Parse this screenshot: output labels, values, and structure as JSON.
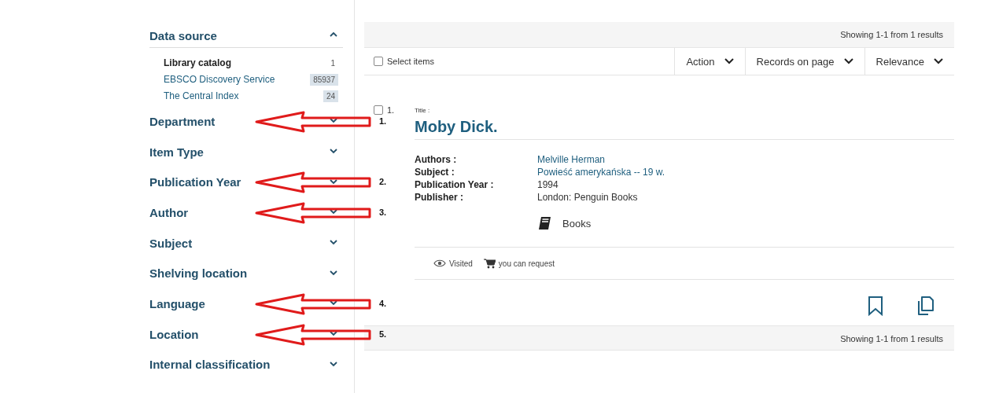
{
  "sidebar": {
    "data_source": {
      "title": "Data source",
      "expanded": true,
      "items": [
        {
          "name": "Library catalog",
          "count": "1",
          "selected": true
        },
        {
          "name": "EBSCO Discovery Service",
          "count": "85937",
          "selected": false
        },
        {
          "name": "The Central Index",
          "count": "24",
          "selected": false
        }
      ]
    },
    "facets": [
      {
        "label": "Department",
        "expanded": false,
        "annotation": "1."
      },
      {
        "label": "Item Type",
        "expanded": false
      },
      {
        "label": "Publication Year",
        "expanded": false,
        "annotation": "2."
      },
      {
        "label": "Author",
        "expanded": false,
        "annotation": "3."
      },
      {
        "label": "Subject",
        "expanded": false
      },
      {
        "label": "Shelving location",
        "expanded": false
      },
      {
        "label": "Language",
        "expanded": false,
        "annotation": "4."
      },
      {
        "label": "Location",
        "expanded": false,
        "annotation": "5."
      },
      {
        "label": "Internal classification",
        "expanded": false
      }
    ]
  },
  "results": {
    "summary_top": "Showing 1-1 from 1 results",
    "select_all": {
      "label": "Select items",
      "checked": false
    },
    "menus": [
      "Action",
      "Records on page",
      "Relevance"
    ],
    "record": {
      "number": "1.",
      "checked": false,
      "title_label": "Title :",
      "title": "Moby Dick.",
      "fields": [
        {
          "label": "Authors :",
          "value": "Melville Herman",
          "link": true
        },
        {
          "label": "Subject :",
          "value": "Powieść amerykańska -- 19 w.",
          "link": true
        },
        {
          "label": "Publication Year :",
          "value": "1994",
          "link": false
        },
        {
          "label": "Publisher :",
          "value": "London: Penguin Books",
          "link": false
        }
      ],
      "format": "Books",
      "status": [
        "Visited",
        "you can request"
      ]
    },
    "summary_bottom": "Showing 1-1 from 1 results"
  }
}
